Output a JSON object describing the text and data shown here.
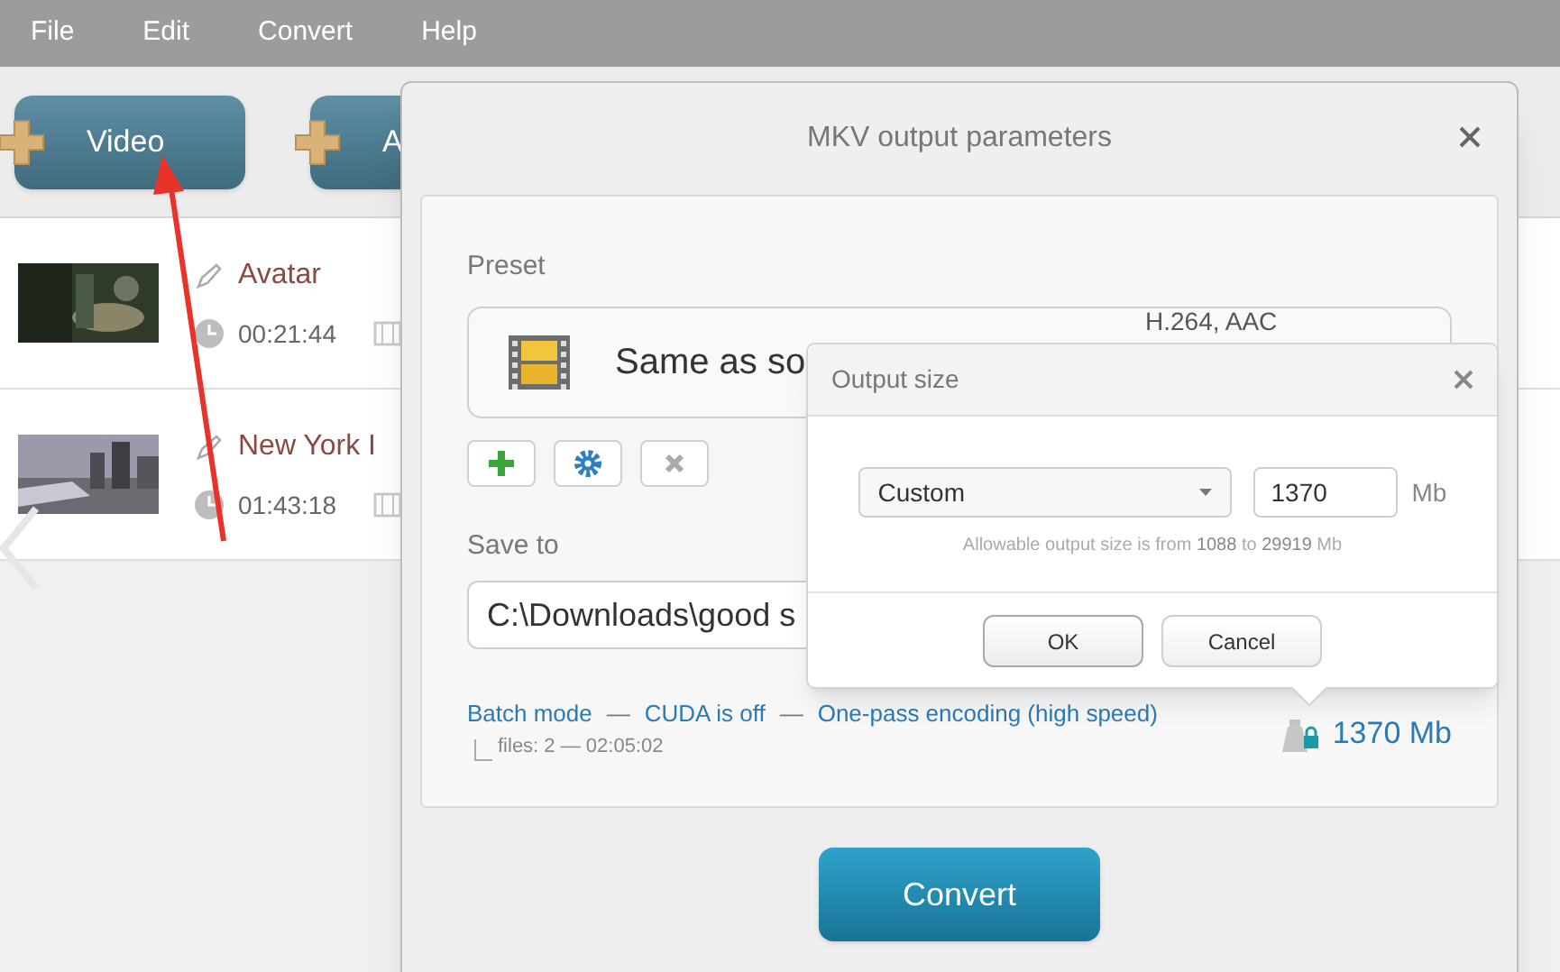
{
  "menu": [
    "File",
    "Edit",
    "Convert",
    "Help"
  ],
  "toolbar": [
    {
      "label": "Video"
    },
    {
      "label": "A"
    }
  ],
  "files": [
    {
      "title": "Avatar",
      "duration": "00:21:44",
      "kind": "picture"
    },
    {
      "title": "New York I",
      "duration": "01:43:18",
      "kind": "picture"
    }
  ],
  "dialog": {
    "title": "MKV output parameters",
    "preset_label": "Preset",
    "preset_name": "Same as so",
    "preset_codecs": "H.264, AAC",
    "save_label": "Save to",
    "save_path": "C:\\Downloads\\good s",
    "links": [
      "Batch mode",
      "CUDA is off",
      "One-pass encoding (high speed)"
    ],
    "separator": "—",
    "files_summary": "files: 2 — 02:05:02",
    "size": "1370 Mb",
    "convert": "Convert"
  },
  "popup": {
    "title": "Output size",
    "mode": "Custom",
    "value": "1370",
    "unit": "Mb",
    "hint": "Allowable output size is from **1088** to **29919** Mb",
    "ok": "OK",
    "cancel": "Cancel"
  }
}
